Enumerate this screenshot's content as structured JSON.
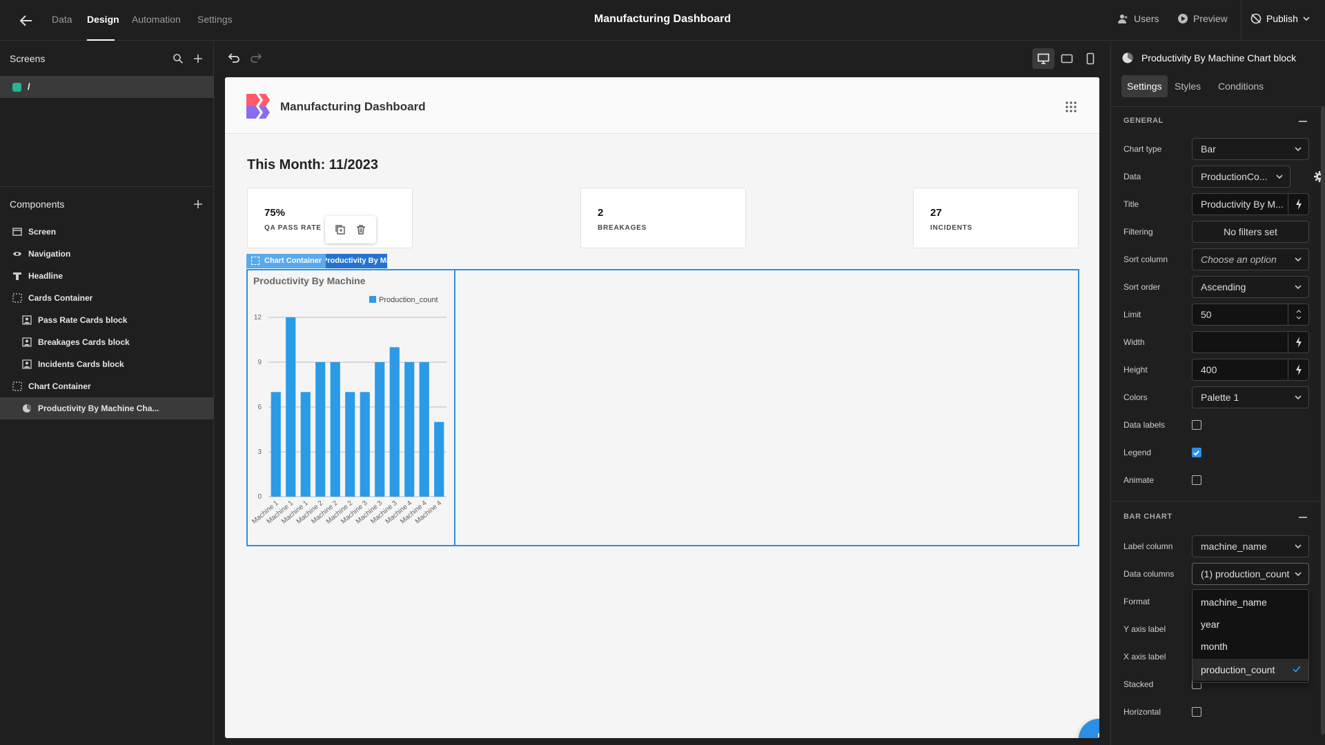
{
  "topbar": {
    "tabs": [
      {
        "label": "Data"
      },
      {
        "label": "Design"
      },
      {
        "label": "Automation"
      },
      {
        "label": "Settings"
      }
    ],
    "app_title": "Manufacturing Dashboard",
    "users_label": "Users",
    "preview_label": "Preview",
    "publish_label": "Publish"
  },
  "left_panel": {
    "screens_title": "Screens",
    "screens": [
      {
        "label": "/",
        "color": "#29b393"
      }
    ],
    "components_title": "Components",
    "components": [
      {
        "label": "Screen",
        "icon": "screen-icon"
      },
      {
        "label": "Navigation",
        "icon": "eye-icon"
      },
      {
        "label": "Headline",
        "icon": "text-icon"
      },
      {
        "label": "Cards Container",
        "icon": "container-icon"
      },
      {
        "label": "Pass Rate Cards block",
        "icon": "card-block-icon"
      },
      {
        "label": "Breakages Cards block",
        "icon": "card-block-icon"
      },
      {
        "label": "Incidents Cards block",
        "icon": "card-block-icon"
      },
      {
        "label": "Chart Container",
        "icon": "container-icon"
      },
      {
        "label": "Productivity By Machine Cha...",
        "icon": "chart-icon",
        "selected": true
      }
    ]
  },
  "page": {
    "nav_title": "Manufacturing Dashboard",
    "headline": "This Month: 11/2023",
    "cards": [
      {
        "value": "75%",
        "label": "QA PASS RATE"
      },
      {
        "value": "2",
        "label": "BREAKAGES"
      },
      {
        "value": "27",
        "label": "INCIDENTS"
      }
    ],
    "tag_container": "Chart Container",
    "tag_block": "Productivity By Machine Chart block"
  },
  "chart_data": {
    "type": "bar",
    "title": "Productivity By Machine",
    "categories": [
      "Machine 1",
      "Machine 1",
      "Machine 1",
      "Machine 2",
      "Machine 2",
      "Machine 2",
      "Machine 3",
      "Machine 3",
      "Machine 3",
      "Machine 4",
      "Machine 4",
      "Machine 4"
    ],
    "series": [
      {
        "name": "Production_count",
        "values": [
          7,
          12,
          7,
          9,
          9,
          7,
          7,
          9,
          10,
          9,
          9,
          5
        ]
      }
    ],
    "yticks": [
      "0",
      "3",
      "6",
      "9",
      "12"
    ],
    "ylim": [
      0,
      12
    ],
    "legend": "top-right",
    "grid": true,
    "colors": {
      "bar": "#2b9be8"
    }
  },
  "right_panel": {
    "title": "Productivity By Machine Chart block",
    "tabs": [
      {
        "label": "Settings"
      },
      {
        "label": "Styles"
      },
      {
        "label": "Conditions"
      }
    ],
    "general_title": "GENERAL",
    "fields": {
      "chart_type": {
        "label": "Chart type",
        "value": "Bar"
      },
      "data": {
        "label": "Data",
        "value": "ProductionCo..."
      },
      "title": {
        "label": "Title",
        "value": "Productivity By M..."
      },
      "filtering": {
        "label": "Filtering",
        "value": "No filters set"
      },
      "sort_column": {
        "label": "Sort column",
        "value": "Choose an option"
      },
      "sort_order": {
        "label": "Sort order",
        "value": "Ascending"
      },
      "limit": {
        "label": "Limit",
        "value": "50"
      },
      "width": {
        "label": "Width",
        "value": ""
      },
      "height": {
        "label": "Height",
        "value": "400"
      },
      "colors": {
        "label": "Colors",
        "value": "Palette 1"
      },
      "data_labels": {
        "label": "Data labels",
        "checked": false
      },
      "legend": {
        "label": "Legend",
        "checked": true
      },
      "animate": {
        "label": "Animate",
        "checked": false
      }
    },
    "bar_chart_title": "BAR CHART",
    "bar_fields": {
      "label_column": {
        "label": "Label column",
        "value": "machine_name"
      },
      "data_columns": {
        "label": "Data columns",
        "value": "(1) production_count"
      },
      "format": {
        "label": "Format"
      },
      "y_axis_label": {
        "label": "Y axis label"
      },
      "x_axis_label": {
        "label": "X axis label"
      },
      "stacked": {
        "label": "Stacked",
        "checked": false
      },
      "horizontal": {
        "label": "Horizontal",
        "checked": false
      }
    },
    "dropdown_options": [
      {
        "label": "machine_name",
        "selected": false
      },
      {
        "label": "year",
        "selected": false
      },
      {
        "label": "month",
        "selected": false
      },
      {
        "label": "production_count",
        "selected": true
      }
    ]
  },
  "colors": {
    "accent": "#2b8fe4",
    "screen_dot": "#29b393"
  }
}
